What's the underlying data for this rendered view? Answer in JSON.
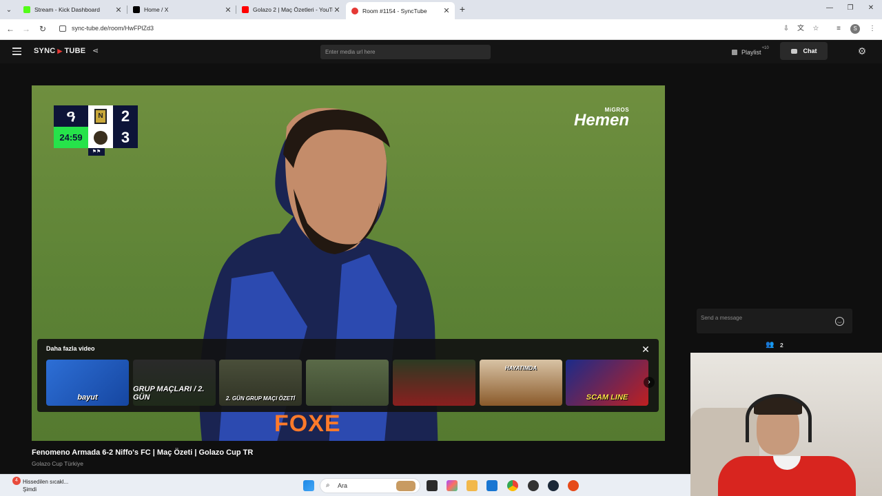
{
  "browser": {
    "tabs": [
      {
        "label": "Stream - Kick Dashboard",
        "favicon_color": "#53fc18",
        "active": false
      },
      {
        "label": "Home / X",
        "favicon_color": "#000000",
        "active": false
      },
      {
        "label": "Golazo 2 | Maç Özetleri - YouTube",
        "favicon_color": "#ff0000",
        "active": false
      },
      {
        "label": "Room #1154 - SyncTube",
        "favicon_color": "#e53935",
        "active": true
      }
    ],
    "url": "sync-tube.de/room/HwFPlZd3"
  },
  "header": {
    "logo_left": "SYNC",
    "logo_right": "TUBE",
    "media_placeholder": "Enter media url here",
    "playlist_label": "Playlist",
    "playlist_badge": "+10",
    "chat_label": "Chat"
  },
  "video": {
    "scoreboard": {
      "team_a_logo": "ዓ",
      "score_a": "2",
      "time": "24:59",
      "score_b": "3",
      "team_b_letter": "N",
      "flags": "⚑⚑"
    },
    "brand_small": "MiGROS",
    "brand_big": "Hemen",
    "shirt_text": "FOXE"
  },
  "related": {
    "title": "Daha fazla video",
    "thumbnails": [
      {
        "caption": "bayut",
        "color": "#2d6fd6"
      },
      {
        "caption": "GRUP MAÇLARI / 2. GÜN",
        "color": "#1f2a1a"
      },
      {
        "caption": "2. GÜN GRUP MAÇI ÖZETİ",
        "color": "#3b3f2e"
      },
      {
        "caption": "",
        "color": "#4a5a3a"
      },
      {
        "caption": "",
        "color": "#2c3a22"
      },
      {
        "caption": "HAYATIMDA",
        "color": "#8a5a2a"
      },
      {
        "caption": "SCAM LINE",
        "color": "#1b2b8a"
      }
    ]
  },
  "now_playing": {
    "title": "Fenomeno Armada 6-2 Niffo's FC | Maç Özeti | Golazo Cup TR",
    "channel": "Golazo Cup Türkiye"
  },
  "chat": {
    "placeholder": "Send a message",
    "user_count": "2"
  },
  "taskbar": {
    "notification_count": "4",
    "weather_line1": "Hissedilen sıcakl...",
    "weather_line2": "Şimdi",
    "search_label": "Ara"
  }
}
